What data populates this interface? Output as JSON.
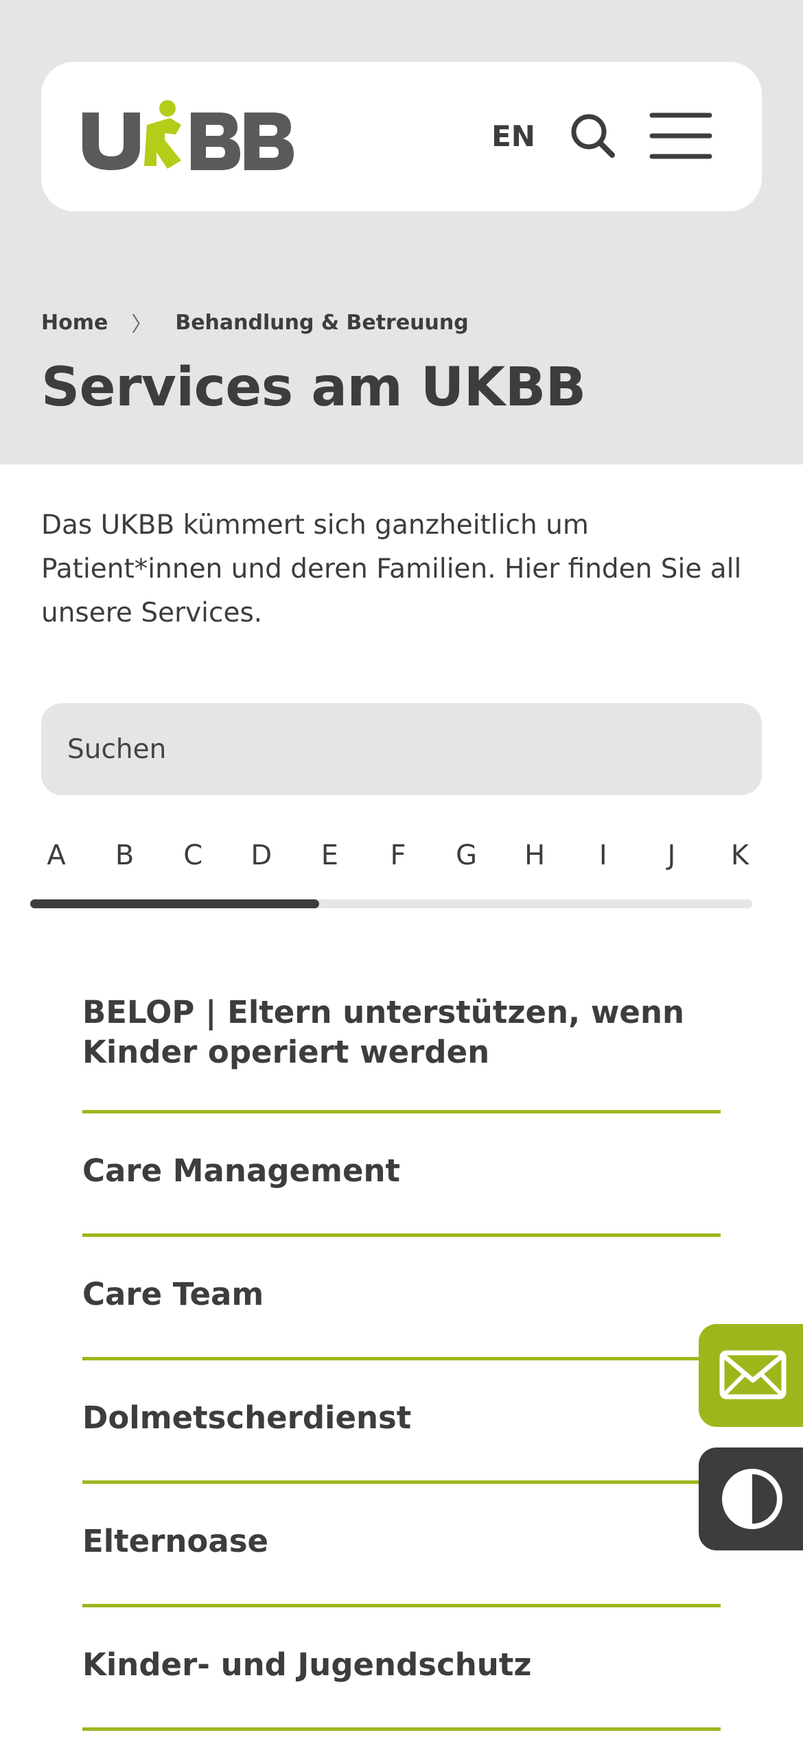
{
  "header": {
    "logo_text": "UKBB",
    "lang_label": "EN"
  },
  "breadcrumb": {
    "home": "Home",
    "separator": "〉",
    "current": "Behandlung & Betreuung"
  },
  "page": {
    "title": "Services am UKBB",
    "intro": "Das UKBB kümmert sich ganzheitlich um Patient*innen und deren Familien. Hier finden Sie all unsere Services."
  },
  "search": {
    "placeholder": "Suchen",
    "value": ""
  },
  "alphabet": {
    "letters": [
      "A",
      "B",
      "C",
      "D",
      "E",
      "F",
      "G",
      "H",
      "I",
      "J",
      "K"
    ],
    "scroll_progress": 0.4
  },
  "services": [
    {
      "label": "BELOP | Eltern unterstützen, wenn Kinder operiert werden"
    },
    {
      "label": "Care Management"
    },
    {
      "label": "Care Team"
    },
    {
      "label": "Dolmetscherdienst"
    },
    {
      "label": "Elternoase"
    },
    {
      "label": "Kinder- und Jugendschutz"
    }
  ],
  "colors": {
    "accent": "#9cb71b",
    "text": "#3d3d3d",
    "hero_bg": "#e5e5e5",
    "dark": "#3d3d3d"
  },
  "icons": {
    "search": "search-icon",
    "menu": "hamburger-menu-icon",
    "contact": "envelope-icon",
    "contrast": "contrast-icon"
  }
}
